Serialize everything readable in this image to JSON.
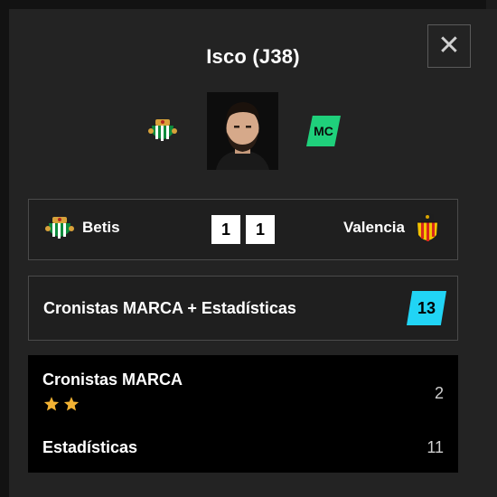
{
  "modal": {
    "title": "Isco (J38)",
    "close_icon": "close-icon",
    "position_badge": "MC"
  },
  "match": {
    "home_team": "Betis",
    "home_score": "1",
    "away_score": "1",
    "away_team": "Valencia"
  },
  "ratings": {
    "total_label": "Cronistas MARCA + Estadísticas",
    "total_value": "13",
    "cronistas_label": "Cronistas MARCA",
    "cronistas_value": "2",
    "cronistas_stars": 2,
    "stats_label": "Estadísticas",
    "stats_value": "11"
  },
  "colors": {
    "position_badge": "#1fd07b",
    "total_badge": "#21d4f5",
    "star": "#f2b233"
  }
}
